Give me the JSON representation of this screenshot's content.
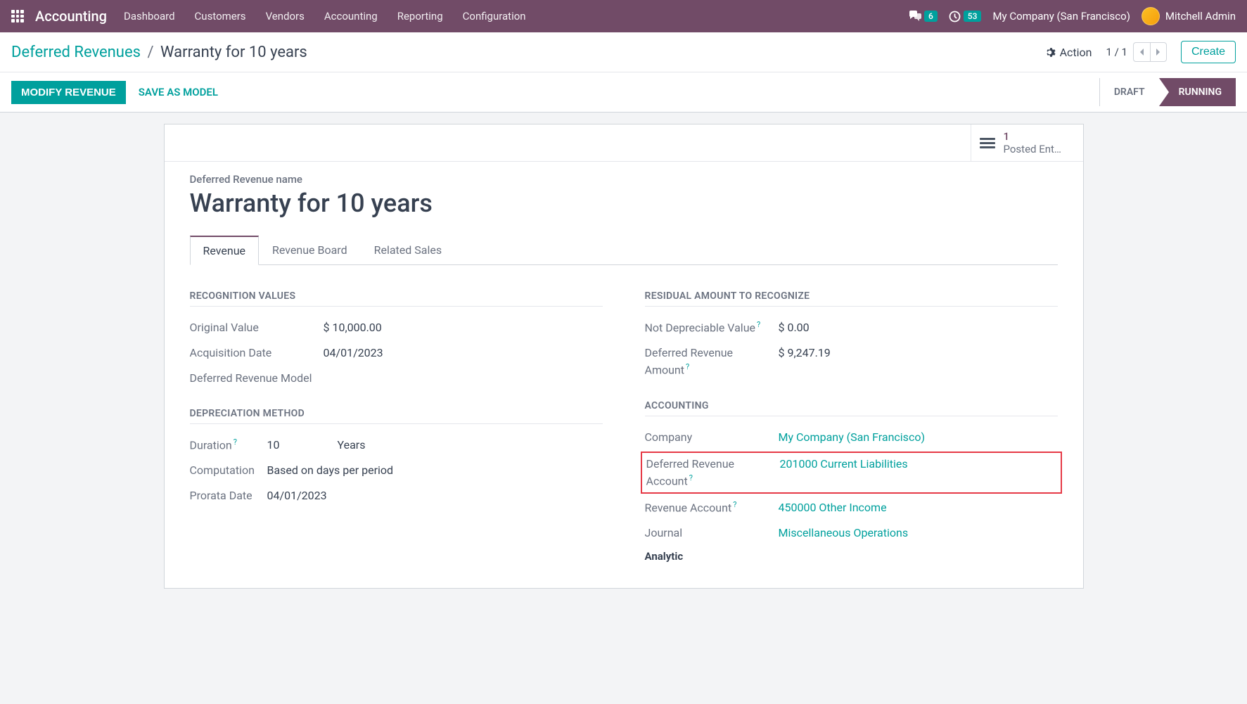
{
  "navbar": {
    "brand": "Accounting",
    "menu": [
      "Dashboard",
      "Customers",
      "Vendors",
      "Accounting",
      "Reporting",
      "Configuration"
    ],
    "chat_badge": "6",
    "clock_badge": "53",
    "company": "My Company (San Francisco)",
    "user": "Mitchell Admin"
  },
  "breadcrumb": {
    "parent": "Deferred Revenues",
    "current": "Warranty for 10 years"
  },
  "controls": {
    "action": "Action",
    "pager": "1 / 1",
    "create": "Create"
  },
  "statusbar": {
    "modify": "MODIFY REVENUE",
    "save_model": "SAVE AS MODEL",
    "draft": "DRAFT",
    "running": "RUNNING"
  },
  "posted": {
    "count": "1",
    "label": "Posted Ent…"
  },
  "form": {
    "name_label": "Deferred Revenue name",
    "name_value": "Warranty for 10 years",
    "tabs": [
      "Revenue",
      "Revenue Board",
      "Related Sales"
    ],
    "sections": {
      "recognition": "RECOGNITION VALUES",
      "depreciation": "DEPRECIATION METHOD",
      "residual": "RESIDUAL AMOUNT TO RECOGNIZE",
      "accounting": "ACCOUNTING",
      "analytic": "Analytic"
    },
    "fields": {
      "original_value_label": "Original Value",
      "original_value": "$ 10,000.00",
      "acquisition_date_label": "Acquisition Date",
      "acquisition_date": "04/01/2023",
      "deferred_model_label": "Deferred Revenue Model",
      "duration_label": "Duration",
      "duration_value": "10",
      "duration_unit": "Years",
      "computation_label": "Computation",
      "computation_value": "Based on days per period",
      "prorata_label": "Prorata Date",
      "prorata_value": "04/01/2023",
      "not_depreciable_label": "Not Depreciable Value",
      "not_depreciable_value": "$ 0.00",
      "deferred_amount_label": "Deferred Revenue Amount",
      "deferred_amount_value": "$ 9,247.19",
      "company_label": "Company",
      "company_value": "My Company (San Francisco)",
      "deferred_account_label": "Deferred Revenue Account",
      "deferred_account_value": "201000 Current Liabilities",
      "revenue_account_label": "Revenue Account",
      "revenue_account_value": "450000 Other Income",
      "journal_label": "Journal",
      "journal_value": "Miscellaneous Operations"
    }
  }
}
